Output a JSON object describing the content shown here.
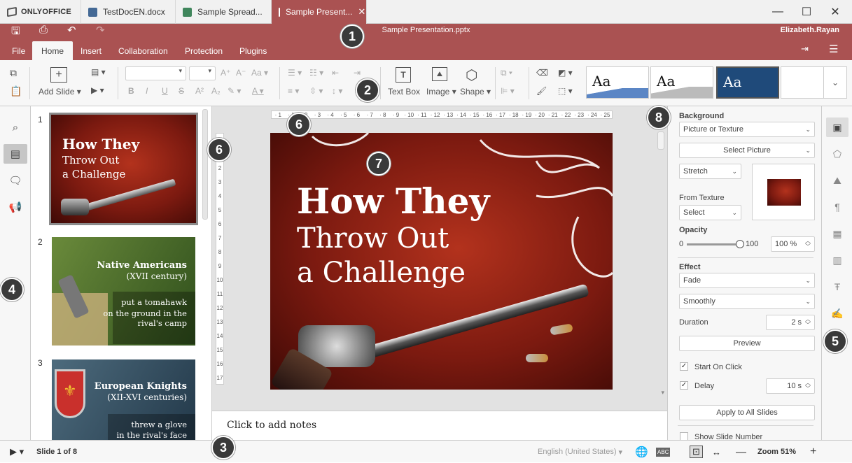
{
  "tabs": [
    {
      "label": "ONLYOFFICE"
    },
    {
      "label": "TestDocEN.docx"
    },
    {
      "label": "Sample Spread..."
    },
    {
      "label": "Sample Present..."
    }
  ],
  "header": {
    "file_name": "Sample Presentation.pptx",
    "user": "Elizabeth.Rayan"
  },
  "menu": [
    "File",
    "Home",
    "Insert",
    "Collaboration",
    "Protection",
    "Plugins"
  ],
  "toolbar": {
    "add_slide": "Add Slide",
    "text_box": "Text Box",
    "image": "Image",
    "shape": "Shape",
    "theme_label": "Aa"
  },
  "thumbnails": [
    {
      "num": "1",
      "line1": "How They",
      "line2": "Throw Out",
      "line3": "a Challenge"
    },
    {
      "num": "2",
      "title": "Native Americans",
      "sub": "(XVII century)",
      "t1": "put a tomahawk",
      "t2": "on the ground in the",
      "t3": "rival's camp"
    },
    {
      "num": "3",
      "title": "European Knights",
      "sub": "(XII-XVI centuries)",
      "t1": "threw a glove",
      "t2": "in the rival's face"
    }
  ],
  "slide": {
    "line1": "How They",
    "line2": "Throw Out",
    "line3": "a Challenge"
  },
  "notes": "Click to add notes",
  "ruler": {
    "h_ticks": [
      "1",
      "1",
      "2",
      "3",
      "4",
      "5",
      "6",
      "7",
      "8",
      "9",
      "10",
      "11",
      "12",
      "13",
      "14",
      "15",
      "16",
      "17",
      "18",
      "19",
      "20",
      "21",
      "22",
      "23",
      "24",
      "25"
    ],
    "v_ticks": [
      "1",
      "1",
      "2",
      "3",
      "4",
      "5",
      "6",
      "7",
      "8",
      "9",
      "10",
      "11",
      "12",
      "13",
      "14",
      "15",
      "16",
      "17",
      "18"
    ]
  },
  "right_panel": {
    "background_label": "Background",
    "fill_type": "Picture or Texture",
    "select_picture": "Select Picture",
    "stretch": "Stretch",
    "from_texture": "From Texture",
    "select": "Select",
    "opacity_label": "Opacity",
    "opacity_min": "0",
    "opacity_max": "100",
    "opacity_value": "100 %",
    "opacity_fraction": 1.0,
    "effect_label": "Effect",
    "effect": "Fade",
    "effect_type": "Smoothly",
    "duration_label": "Duration",
    "duration": "2 s",
    "preview": "Preview",
    "start_on_click": "Start On Click",
    "delay": "Delay",
    "delay_value": "10 s",
    "apply_all": "Apply to All Slides",
    "show_slide_number": "Show Slide Number"
  },
  "status": {
    "slide_info": "Slide 1 of 8",
    "language": "English (United States)",
    "zoom": "Zoom 51%"
  },
  "callouts": [
    "1",
    "2",
    "3",
    "4",
    "5",
    "6",
    "6",
    "7",
    "8"
  ],
  "colors": {
    "accent": "#aa5252",
    "panel": "#f7f7f7"
  }
}
